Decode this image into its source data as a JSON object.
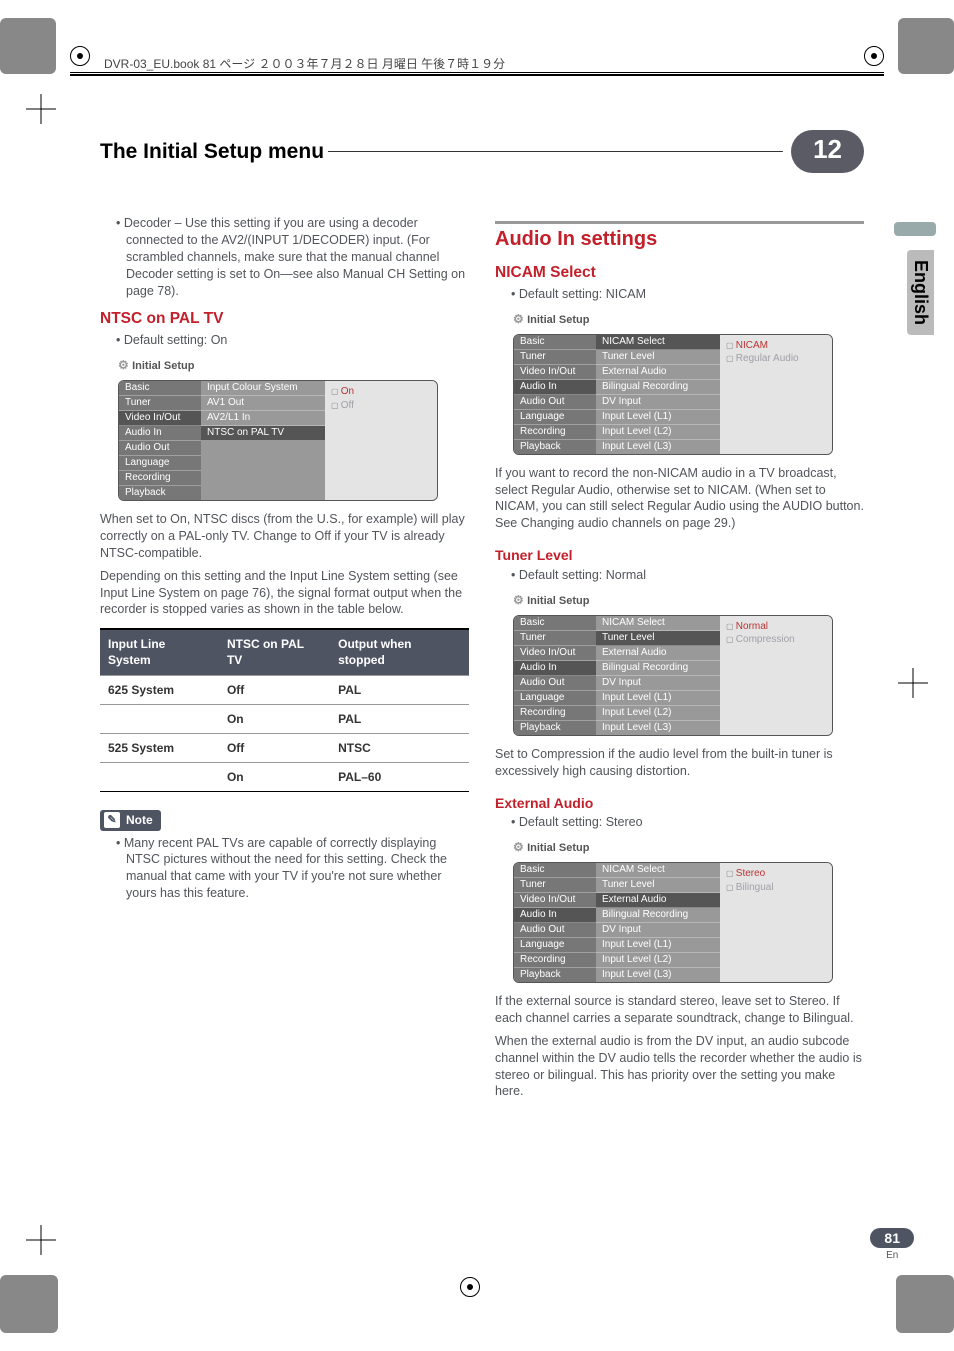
{
  "file_header": "DVR-03_EU.book 81 ページ ２００３年７月２８日 月曜日 午後７時１９分",
  "title_bar": {
    "title": "The Initial Setup menu",
    "chapter": "12"
  },
  "side_tab": "English",
  "page": {
    "num": "81",
    "lang": "En"
  },
  "left": {
    "decoder_para": "Decoder – Use this setting if you are using a decoder connected to the AV2/(INPUT 1/DECODER) input. (For scrambled channels, make sure that the manual channel Decoder setting is set to On—see also Manual CH Setting on page 78).",
    "ntsc_heading": "NTSC on PAL TV",
    "ntsc_default": "Default setting: On",
    "ntsc_ui": {
      "title": "Initial Setup",
      "left_items": [
        "Basic",
        "Tuner",
        "Video In/Out",
        "Audio In",
        "Audio Out",
        "Language",
        "Recording",
        "Playback"
      ],
      "mid_items": [
        "Input Colour System",
        "AV1 Out",
        "AV2/L1 In",
        "NTSC on PAL TV"
      ],
      "right_items": [
        "On",
        "Off"
      ],
      "selected_left": "Video In/Out",
      "selected_mid": "NTSC on PAL TV",
      "selected_right": "On"
    },
    "ntsc_p1": "When set to On, NTSC discs (from the U.S., for example) will play correctly on a PAL-only TV. Change to Off if your TV is already NTSC-compatible.",
    "ntsc_p2": "Depending on this setting and the Input Line System setting (see Input Line System on page 76), the signal format output when the recorder is stopped varies as shown in the table below.",
    "table": {
      "headers": [
        "Input Line System",
        "NTSC on PAL TV",
        "Output when stopped"
      ],
      "rows": [
        [
          "625 System",
          "Off",
          "PAL"
        ],
        [
          "",
          "On",
          "PAL"
        ],
        [
          "525 System",
          "Off",
          "NTSC"
        ],
        [
          "",
          "On",
          "PAL–60"
        ]
      ]
    },
    "note_label": "Note",
    "note_text": "Many recent PAL TVs are capable of correctly displaying NTSC pictures without the need for this setting. Check the manual that came with your TV if you're not sure whether yours has this feature."
  },
  "right": {
    "audio_heading": "Audio In settings",
    "nicam_heading": "NICAM Select",
    "nicam_default": "Default setting: NICAM",
    "nicam_ui": {
      "title": "Initial Setup",
      "left_items": [
        "Basic",
        "Tuner",
        "Video In/Out",
        "Audio In",
        "Audio Out",
        "Language",
        "Recording",
        "Playback"
      ],
      "mid_items": [
        "NICAM Select",
        "Tuner Level",
        "External Audio",
        "Bilingual Recording",
        "DV Input",
        "Input Level (L1)",
        "Input Level (L2)",
        "Input Level (L3)"
      ],
      "right_items": [
        "NICAM",
        "Regular Audio"
      ],
      "selected_left": "Audio In",
      "selected_mid": "NICAM Select",
      "selected_right": "NICAM"
    },
    "nicam_p": "If you want to record the non-NICAM audio in a TV broadcast, select Regular Audio, otherwise set to NICAM. (When set to NICAM, you can still select Regular Audio using the AUDIO button. See Changing audio channels on page 29.)",
    "tuner_heading": "Tuner Level",
    "tuner_default": "Default setting: Normal",
    "tuner_ui": {
      "title": "Initial Setup",
      "left_items": [
        "Basic",
        "Tuner",
        "Video In/Out",
        "Audio In",
        "Audio Out",
        "Language",
        "Recording",
        "Playback"
      ],
      "mid_items": [
        "NICAM Select",
        "Tuner Level",
        "External Audio",
        "Bilingual Recording",
        "DV Input",
        "Input Level (L1)",
        "Input Level (L2)",
        "Input Level (L3)"
      ],
      "right_items": [
        "Normal",
        "Compression"
      ],
      "selected_left": "Audio In",
      "selected_mid": "Tuner Level",
      "selected_right": "Normal"
    },
    "tuner_p": "Set to Compression if the audio level from the built-in tuner is excessively high causing distortion.",
    "ext_heading": "External Audio",
    "ext_default": "Default setting: Stereo",
    "ext_ui": {
      "title": "Initial Setup",
      "left_items": [
        "Basic",
        "Tuner",
        "Video In/Out",
        "Audio In",
        "Audio Out",
        "Language",
        "Recording",
        "Playback"
      ],
      "mid_items": [
        "NICAM Select",
        "Tuner Level",
        "External Audio",
        "Bilingual Recording",
        "DV Input",
        "Input Level (L1)",
        "Input Level (L2)",
        "Input Level (L3)"
      ],
      "right_items": [
        "Stereo",
        "Bilingual"
      ],
      "selected_left": "Audio In",
      "selected_mid": "External Audio",
      "selected_right": "Stereo"
    },
    "ext_p1": "If the external source is standard stereo, leave set to Stereo. If each channel carries a separate soundtrack, change to Bilingual.",
    "ext_p2": "When the external audio is from the DV input, an audio subcode channel within the DV audio tells the recorder whether the audio is stereo or bilingual. This has priority over the setting you make here."
  }
}
